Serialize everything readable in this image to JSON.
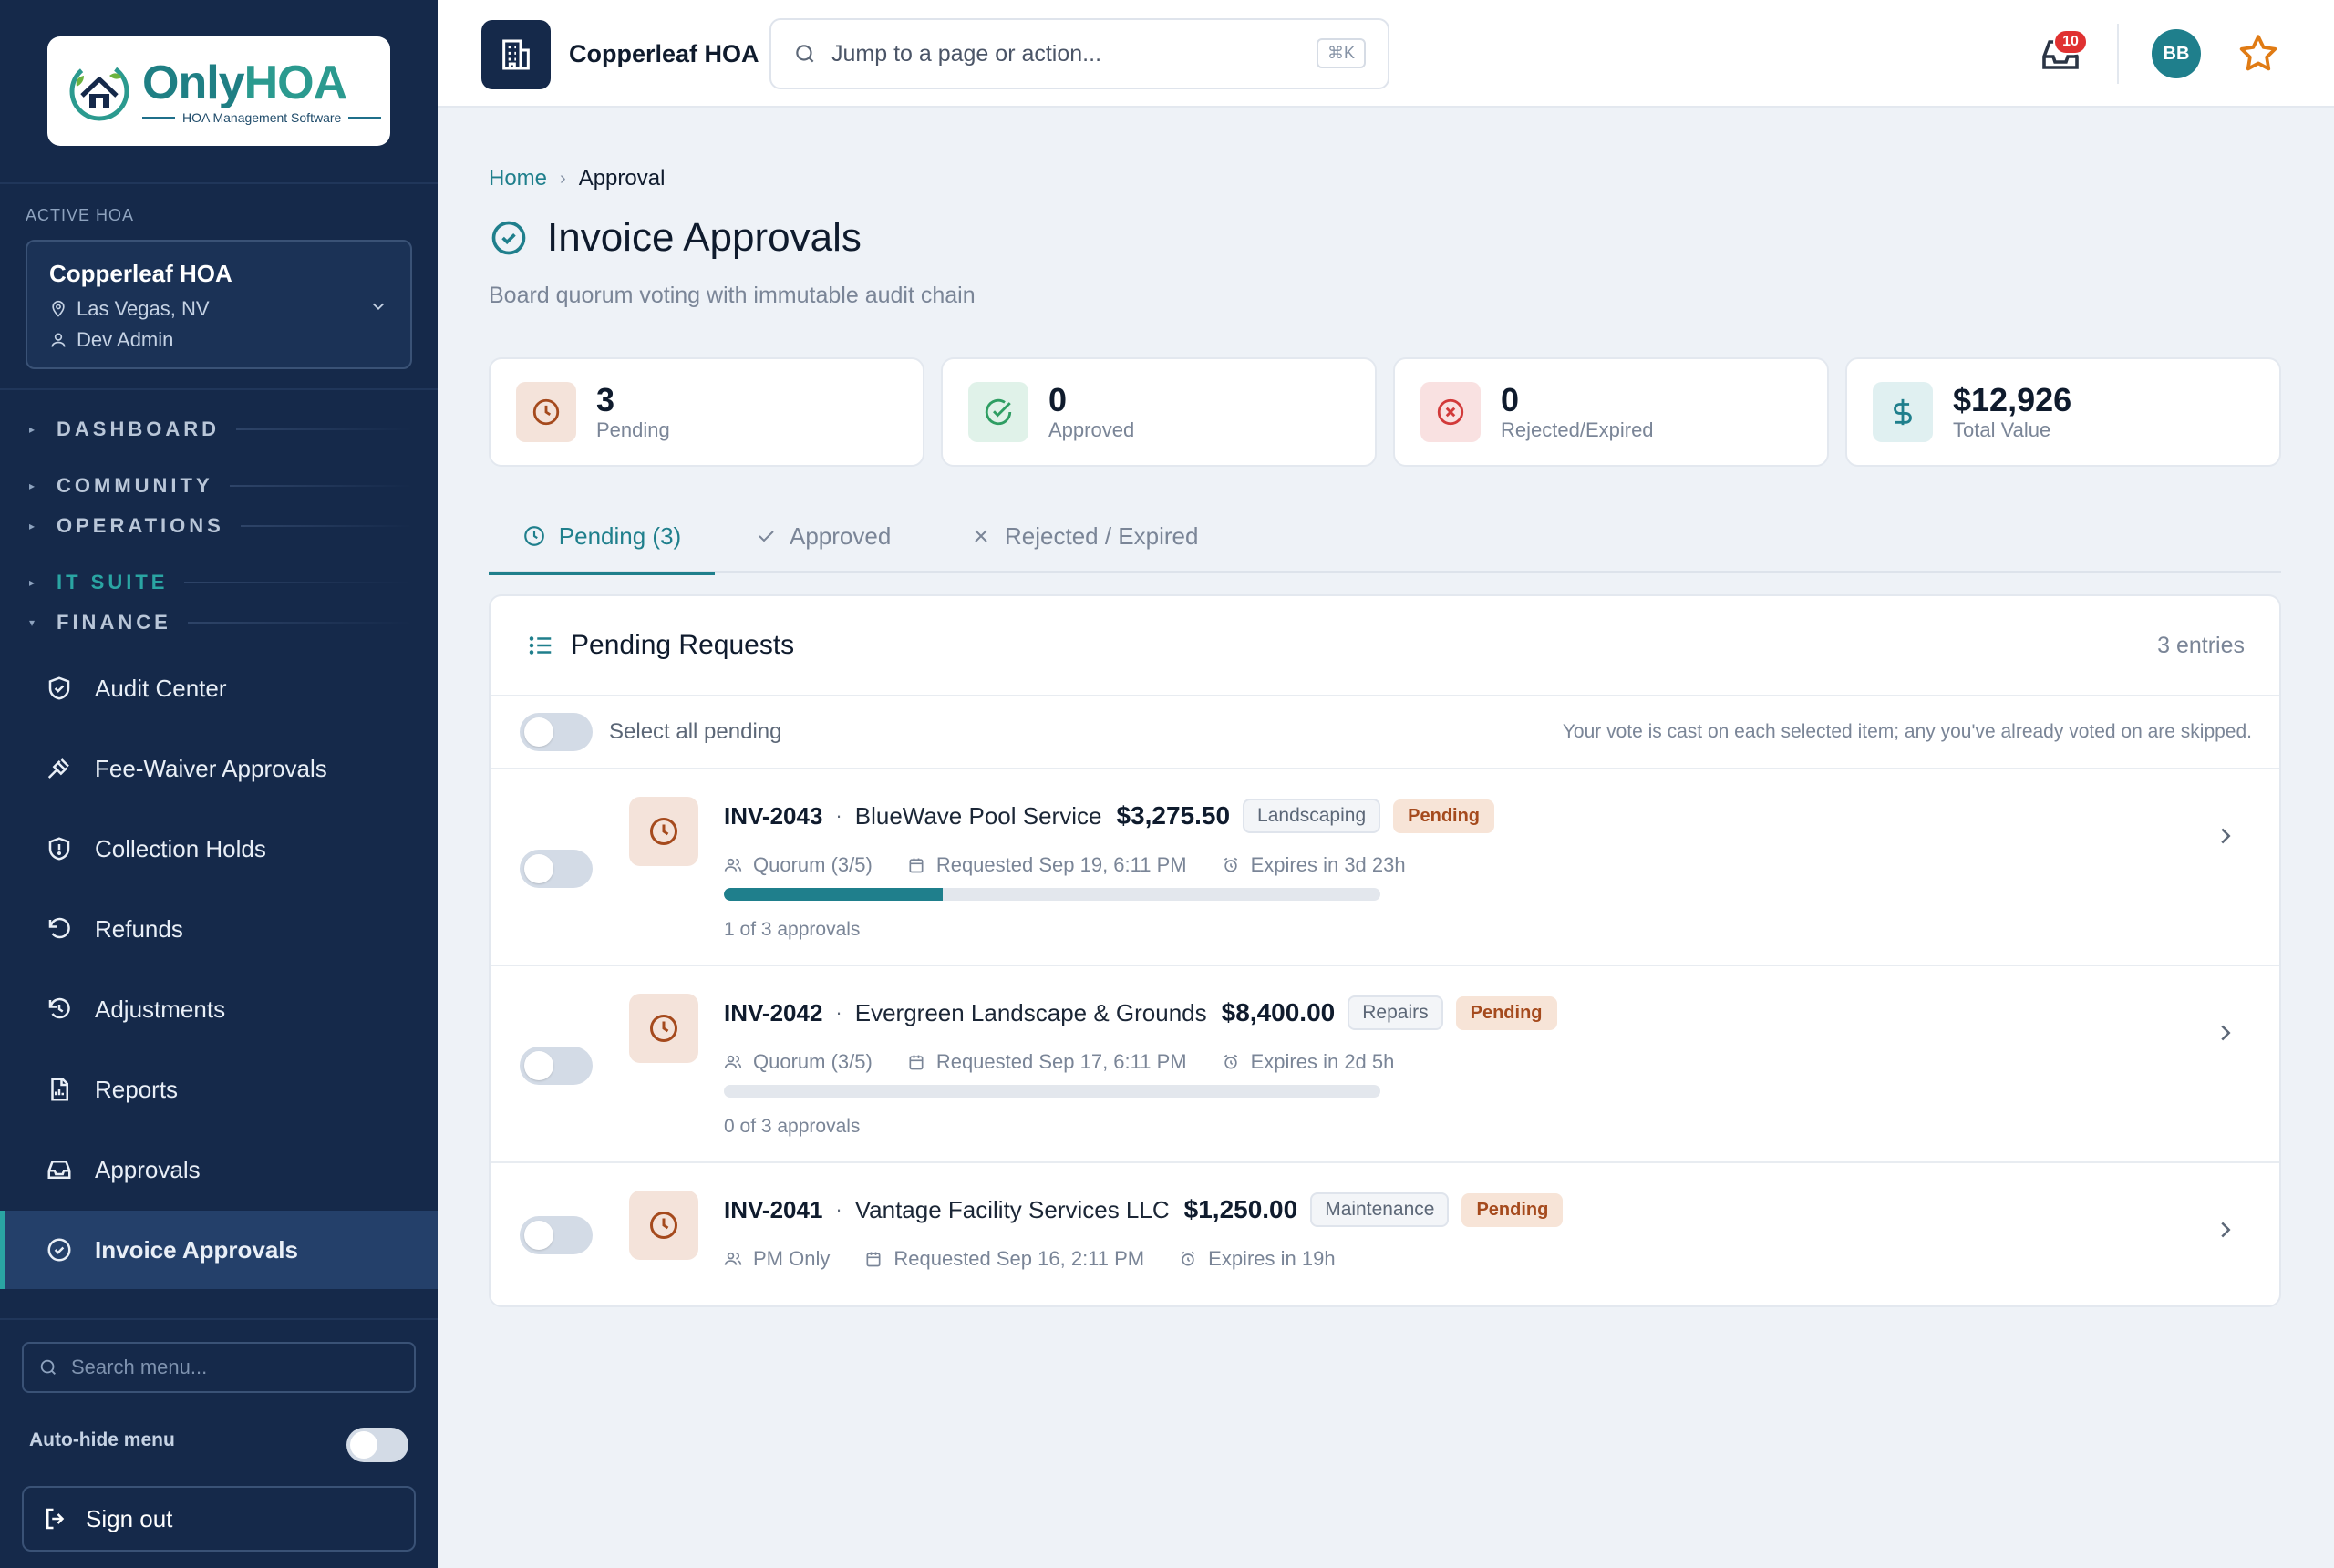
{
  "sidebar": {
    "logo": {
      "brand_only": "Only",
      "brand_hoa": "HOA",
      "tagline": "HOA Management Software"
    },
    "active_label": "ACTIVE HOA",
    "hoa": {
      "name": "Copperleaf HOA",
      "location": "Las Vegas, NV",
      "user": "Dev Admin"
    },
    "sections": [
      {
        "label": "DASHBOARD",
        "style": "default"
      },
      {
        "label": "COMMUNITY",
        "style": "default"
      },
      {
        "label": "OPERATIONS",
        "style": "default"
      },
      {
        "label": "IT SUITE",
        "style": "teal"
      },
      {
        "label": "FINANCE",
        "style": "default"
      }
    ],
    "items": [
      {
        "label": "Audit Center",
        "icon": "shield-check-icon"
      },
      {
        "label": "Fee-Waiver Approvals",
        "icon": "gavel-icon"
      },
      {
        "label": "Collection Holds",
        "icon": "shield-alert-icon"
      },
      {
        "label": "Refunds",
        "icon": "rotate-ccw-icon"
      },
      {
        "label": "Adjustments",
        "icon": "history-icon"
      },
      {
        "label": "Reports",
        "icon": "report-icon"
      },
      {
        "label": "Approvals",
        "icon": "inbox-icon"
      },
      {
        "label": "Invoice Approvals",
        "icon": "check-circle-icon",
        "active": true
      }
    ],
    "search_placeholder": "Search menu...",
    "autohide_label": "Auto-hide menu",
    "signout_label": "Sign out"
  },
  "topbar": {
    "org_name": "Copperleaf HOA",
    "search_placeholder": "Jump to a page or action...",
    "shortcut": "⌘K",
    "inbox_count": "10",
    "avatar_initials": "BB"
  },
  "breadcrumb": {
    "home": "Home",
    "current": "Approval"
  },
  "page": {
    "title": "Invoice Approvals",
    "subtitle": "Board quorum voting with immutable audit chain"
  },
  "stats": [
    {
      "value": "3",
      "label": "Pending",
      "icon": "clock-icon",
      "color": "#a54a1d",
      "bg": "#f4e3da"
    },
    {
      "value": "0",
      "label": "Approved",
      "icon": "check-circle-icon",
      "color": "#2f9e63",
      "bg": "#e0f2e9"
    },
    {
      "value": "0",
      "label": "Rejected/Expired",
      "icon": "x-circle-icon",
      "color": "#d23a3a",
      "bg": "#f9e1e1"
    },
    {
      "value": "$12,926",
      "label": "Total Value",
      "icon": "dollar-icon",
      "color": "#1f7f8c",
      "bg": "#e0f0f1"
    }
  ],
  "tabs": [
    {
      "label": "Pending (3)",
      "icon": "clock-icon",
      "active": true
    },
    {
      "label": "Approved",
      "icon": "check-icon",
      "active": false
    },
    {
      "label": "Rejected / Expired",
      "icon": "x-icon",
      "active": false
    }
  ],
  "panel": {
    "title": "Pending Requests",
    "count": "3 entries",
    "select_all_label": "Select all pending",
    "hint": "Your vote is cast on each selected item; any you've already voted on are skipped."
  },
  "requests": [
    {
      "id": "INV-2043",
      "vendor": "BlueWave Pool Service",
      "amount": "$3,275.50",
      "category": "Landscaping",
      "status": "Pending",
      "quorum": "Quorum (3/5)",
      "requested": "Requested Sep 19, 6:11 PM",
      "expires": "Expires in 3d 23h",
      "progress": 0.333,
      "approvals_text": "1 of 3 approvals"
    },
    {
      "id": "INV-2042",
      "vendor": "Evergreen Landscape & Grounds",
      "amount": "$8,400.00",
      "category": "Repairs",
      "status": "Pending",
      "quorum": "Quorum (3/5)",
      "requested": "Requested Sep 17, 6:11 PM",
      "expires": "Expires in 2d 5h",
      "progress": 0,
      "approvals_text": "0 of 3 approvals"
    },
    {
      "id": "INV-2041",
      "vendor": "Vantage Facility Services LLC",
      "amount": "$1,250.00",
      "category": "Maintenance",
      "status": "Pending",
      "quorum": "PM Only",
      "requested": "Requested Sep 16, 2:11 PM",
      "expires": "Expires in 19h"
    }
  ]
}
